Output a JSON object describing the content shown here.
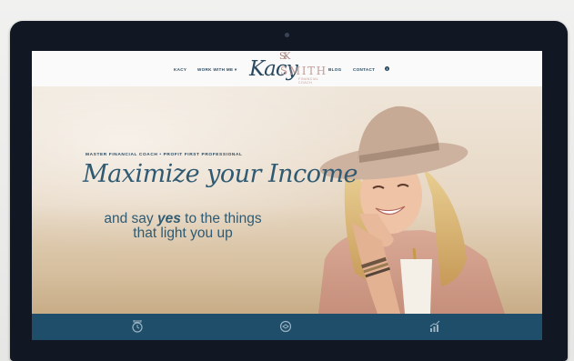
{
  "nav": {
    "items": [
      {
        "label": "KACY"
      },
      {
        "label": "WORK WITH ME ▾"
      },
      {
        "label": "BLOG"
      },
      {
        "label": "CONTACT"
      }
    ],
    "logo": {
      "script": "Kacy",
      "wordmark": "SMITH",
      "tagline": "FINANCIAL COACH",
      "monogram": "SK"
    },
    "info_icon": "i"
  },
  "hero": {
    "eyebrow": "MASTER FINANCIAL COACH • PROFIT FIRST PROFESSIONAL",
    "headline": "Maximize your Income",
    "sub_line1_pre": "and say ",
    "sub_yes": "yes",
    "sub_line1_post": " to the things",
    "sub_line2": "that light you up"
  },
  "bottom_bar": {
    "icons": [
      "clock-icon",
      "handshake-icon",
      "chart-icon"
    ]
  },
  "colors": {
    "nav_text": "#2b4a5f",
    "headline": "#2f5a72",
    "logo_accent": "#c39d98",
    "bar": "#1f4e6a",
    "bezel": "#121823"
  }
}
